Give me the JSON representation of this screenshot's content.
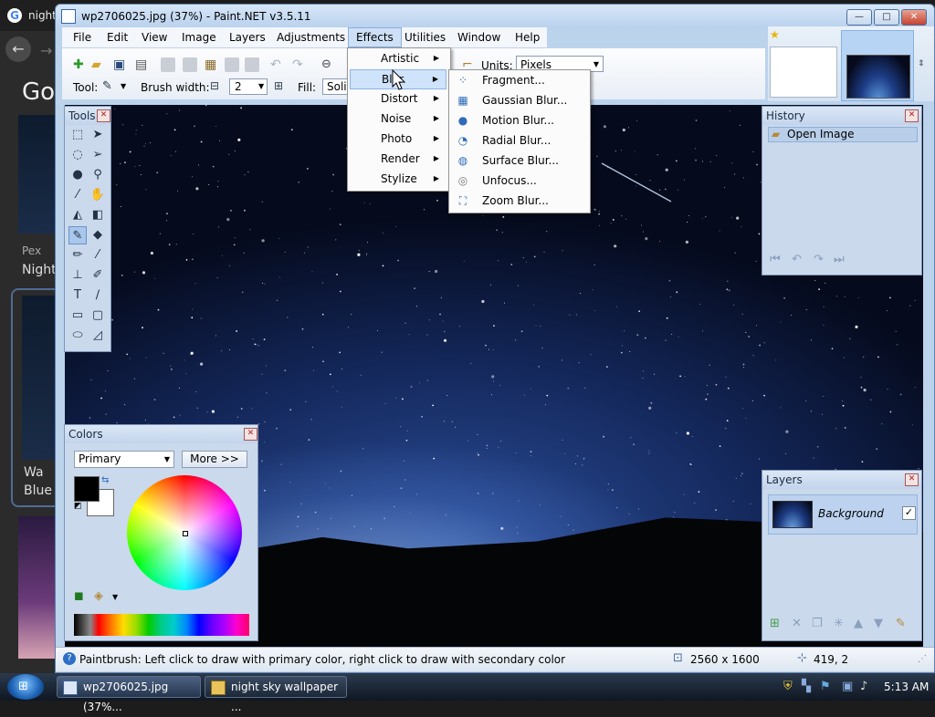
{
  "browser": {
    "tab_title": "night",
    "google_text": "Go",
    "result1_source": "Pex",
    "result1_title": "Night",
    "result2_title": "Wa",
    "result2_subtitle": "Blue"
  },
  "window": {
    "title": "wp2706025.jpg (37%) - Paint.NET v3.5.11",
    "min_label": "—",
    "max_label": "□",
    "close_label": "✕"
  },
  "menubar": [
    "File",
    "Edit",
    "View",
    "Image",
    "Layers",
    "Adjustments",
    "Effects",
    "Utilities",
    "Window",
    "Help"
  ],
  "toolbar": {
    "units_label": "Units:",
    "units_value": "Pixels",
    "tool_label": "Tool:",
    "brush_width_label": "Brush width:",
    "brush_width_value": "2",
    "fill_label": "Fill:",
    "fill_value": "Solic"
  },
  "effects_menu": [
    "Artistic",
    "Blur",
    "Distort",
    "Noise",
    "Photo",
    "Render",
    "Stylize"
  ],
  "blur_menu": [
    "Fragment...",
    "Gaussian Blur...",
    "Motion Blur...",
    "Radial Blur...",
    "Surface Blur...",
    "Unfocus...",
    "Zoom Blur..."
  ],
  "tools_panel": {
    "title": "Tools"
  },
  "colors_panel": {
    "title": "Colors",
    "mode": "Primary",
    "more_button": "More >>"
  },
  "history_panel": {
    "title": "History",
    "item": "Open Image"
  },
  "layers_panel": {
    "title": "Layers",
    "layer_name": "Background",
    "visible": "✓"
  },
  "status": {
    "hint": "Paintbrush: Left click to draw with primary color, right click to draw with secondary color",
    "image_size": "2560 x 1600",
    "cursor_pos": "419, 2"
  },
  "taskbar": {
    "task1": "wp2706025.jpg (37%...",
    "task2": "night sky wallpaper ...",
    "clock": "5:13 AM"
  },
  "icons": {
    "start": "⊞",
    "star": "★"
  }
}
